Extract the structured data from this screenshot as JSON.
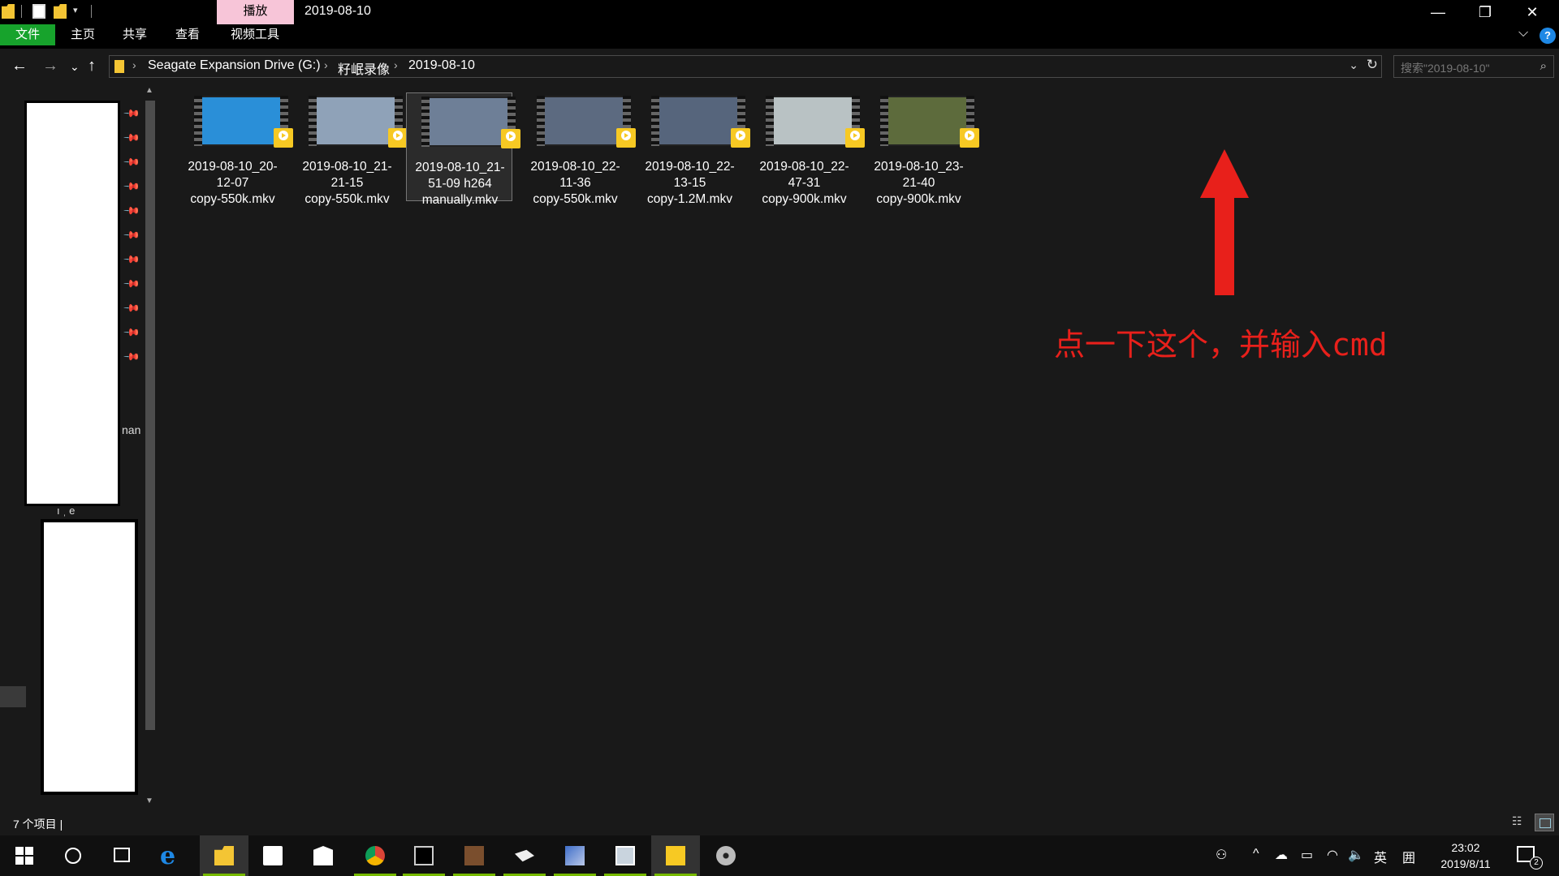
{
  "titlebar": {
    "context_tab": "播放",
    "window_title": "2019-08-10",
    "minimize": "—",
    "restore": "❐",
    "close": "✕"
  },
  "ribbon": {
    "tabs": [
      "文件",
      "主页",
      "共享",
      "查看",
      "视频工具"
    ],
    "expand": "⌵",
    "help": "?"
  },
  "nav": {
    "back": "←",
    "forward": "→",
    "recent": "⌄",
    "up": "↑"
  },
  "address": {
    "crumbs": [
      "Seagate Expansion Drive (G:)",
      "籽岷录像",
      "2019-08-10"
    ],
    "separator": "›"
  },
  "search": {
    "placeholder": "搜索\"2019-08-10\""
  },
  "navpane": {
    "partial_text_1": "nan",
    "partial_text_2": "ı ˌ e"
  },
  "files": [
    {
      "line1": "2019-08-10_20-",
      "line2": "12-07",
      "line3": "copy-550k.mkv",
      "thumb_color": "#2a8fd8",
      "badge": "Player"
    },
    {
      "line1": "2019-08-10_21-",
      "line2": "21-15",
      "line3": "copy-550k.mkv",
      "thumb_color": "#8fa2b8",
      "badge": "Player"
    },
    {
      "line1": "2019-08-10_21-",
      "line2": "51-09 h264",
      "line3": "manually.mkv",
      "thumb_color": "#6e7f97",
      "badge": "Player"
    },
    {
      "line1": "2019-08-10_22-",
      "line2": "11-36",
      "line3": "copy-550k.mkv",
      "thumb_color": "#5c6a80",
      "badge": "Player"
    },
    {
      "line1": "2019-08-10_22-",
      "line2": "13-15",
      "line3": "copy-1.2M.mkv",
      "thumb_color": "#56657c",
      "badge": "Player"
    },
    {
      "line1": "2019-08-10_22-",
      "line2": "47-31",
      "line3": "copy-900k.mkv",
      "thumb_color": "#b9c2c4",
      "badge": "Player"
    },
    {
      "line1": "2019-08-10_23-",
      "line2": "21-40",
      "line3": "copy-900k.mkv",
      "thumb_color": "#5d6b3c",
      "badge": "Player"
    }
  ],
  "annotation": {
    "text": "点一下这个，并输入cmd",
    "color": "#e8201b"
  },
  "status": {
    "item_count": "7 个项目  |"
  },
  "taskbar": {
    "tray_lang": "英",
    "tray_ime": "囲",
    "time": "23:02",
    "date": "2019/8/11",
    "notification_count": "2",
    "accent": "#76b900"
  }
}
